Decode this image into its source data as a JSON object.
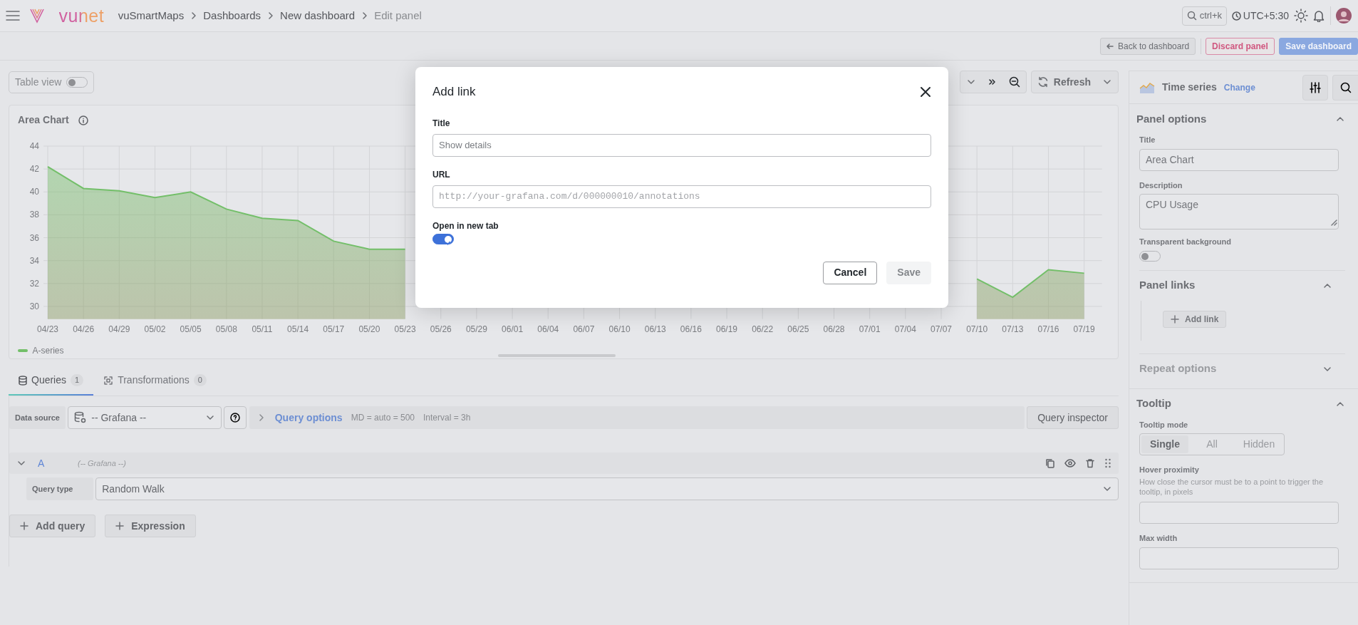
{
  "header": {
    "logo_text": "vunet",
    "breadcrumbs": [
      {
        "label": "vuSmartMaps",
        "current": false
      },
      {
        "label": "Dashboards",
        "current": false
      },
      {
        "label": "New dashboard",
        "current": false
      },
      {
        "label": "Edit panel",
        "current": true
      }
    ],
    "search_hint": "ctrl+k",
    "timezone": "UTC+5:30"
  },
  "actions": [
    {
      "label": "Back to dashboard",
      "kind": "back"
    },
    {
      "label": "Discard panel",
      "kind": "danger"
    },
    {
      "label": "Save dashboard",
      "kind": "primary"
    }
  ],
  "toolbar": {
    "table_view": {
      "label": "Table view",
      "on": false
    },
    "refresh_label": "Refresh"
  },
  "chart_panel": {
    "title": "Area Chart",
    "chart_data": {
      "type": "area",
      "x": [
        "04/23",
        "04/26",
        "04/29",
        "05/02",
        "05/05",
        "05/08",
        "05/11",
        "05/14",
        "05/17",
        "05/20",
        "05/23",
        "05/26",
        "05/29",
        "06/01",
        "06/04",
        "06/07",
        "06/10",
        "06/13",
        "06/16",
        "06/19",
        "06/22",
        "06/25",
        "06/28",
        "07/01",
        "07/04",
        "07/07",
        "07/10",
        "07/13",
        "07/16",
        "07/19"
      ],
      "series": [
        {
          "name": "A-series",
          "color": "#73bf69",
          "values": [
            42.2,
            40.3,
            40.1,
            39.5,
            40.0,
            38.5,
            37.7,
            37.5,
            35.7,
            35.0,
            35.0,
            null,
            null,
            null,
            null,
            null,
            null,
            null,
            null,
            null,
            null,
            null,
            null,
            null,
            null,
            null,
            32.4,
            30.8,
            33.2,
            32.9
          ]
        }
      ],
      "ylim": [
        28.9,
        44
      ],
      "yticks": [
        30,
        32,
        34,
        36,
        38,
        40,
        42,
        44
      ],
      "grid": true
    }
  },
  "query_tabs": [
    {
      "label": "Queries",
      "count": "1",
      "selected": true
    },
    {
      "label": "Transformations",
      "count": "0",
      "selected": false
    }
  ],
  "data_source": {
    "label": "Data source",
    "value": "-- Grafana --"
  },
  "query_options": {
    "label": "Query options",
    "md": "MD = auto = 500",
    "interval": "Interval = 3h"
  },
  "query_inspector": "Query inspector",
  "queries": [
    {
      "ref": "A",
      "source": "(-- Grafana --)",
      "expanded": true,
      "type_label": "Query type",
      "type_value": "Random Walk"
    }
  ],
  "add_buttons": [
    {
      "label": "Add query"
    },
    {
      "label": "Expression"
    }
  ],
  "side_panel": {
    "viz_name": "Time series",
    "change_label": "Change",
    "sections": [
      {
        "title": "Panel options",
        "expanded": true,
        "items": [
          {
            "kind": "text",
            "label": "Title",
            "value": "Area Chart"
          },
          {
            "kind": "textarea",
            "label": "Description",
            "value": "CPU Usage"
          },
          {
            "kind": "switch",
            "label": "Transparent background",
            "on": false
          }
        ],
        "subsections": [
          {
            "title": "Panel links",
            "expanded": true,
            "items": [
              {
                "kind": "button",
                "label": "Add link"
              }
            ]
          },
          {
            "title": "Repeat options",
            "expanded": false
          }
        ]
      },
      {
        "title": "Tooltip",
        "expanded": true,
        "items": [
          {
            "kind": "radio",
            "label": "Tooltip mode",
            "options": [
              {
                "label": "Single",
                "selected": true
              },
              {
                "label": "All",
                "selected": false
              },
              {
                "label": "Hidden",
                "selected": false
              }
            ]
          },
          {
            "kind": "number",
            "label": "Hover proximity",
            "description": "How close the cursor must be to a point to trigger the tooltip, in pixels"
          },
          {
            "kind": "number",
            "label": "Max width"
          }
        ]
      }
    ]
  },
  "modal": {
    "title": "Add link",
    "fields": [
      {
        "label": "Title",
        "placeholder": "Show details",
        "kind": "text"
      },
      {
        "label": "URL",
        "placeholder": "http://your-grafana.com/d/000000010/annotations",
        "kind": "url"
      }
    ],
    "toggle": {
      "label": "Open in new tab",
      "on": true
    },
    "buttons": [
      {
        "label": "Cancel",
        "kind": "secondary"
      },
      {
        "label": "Save",
        "kind": "disabled"
      }
    ]
  }
}
